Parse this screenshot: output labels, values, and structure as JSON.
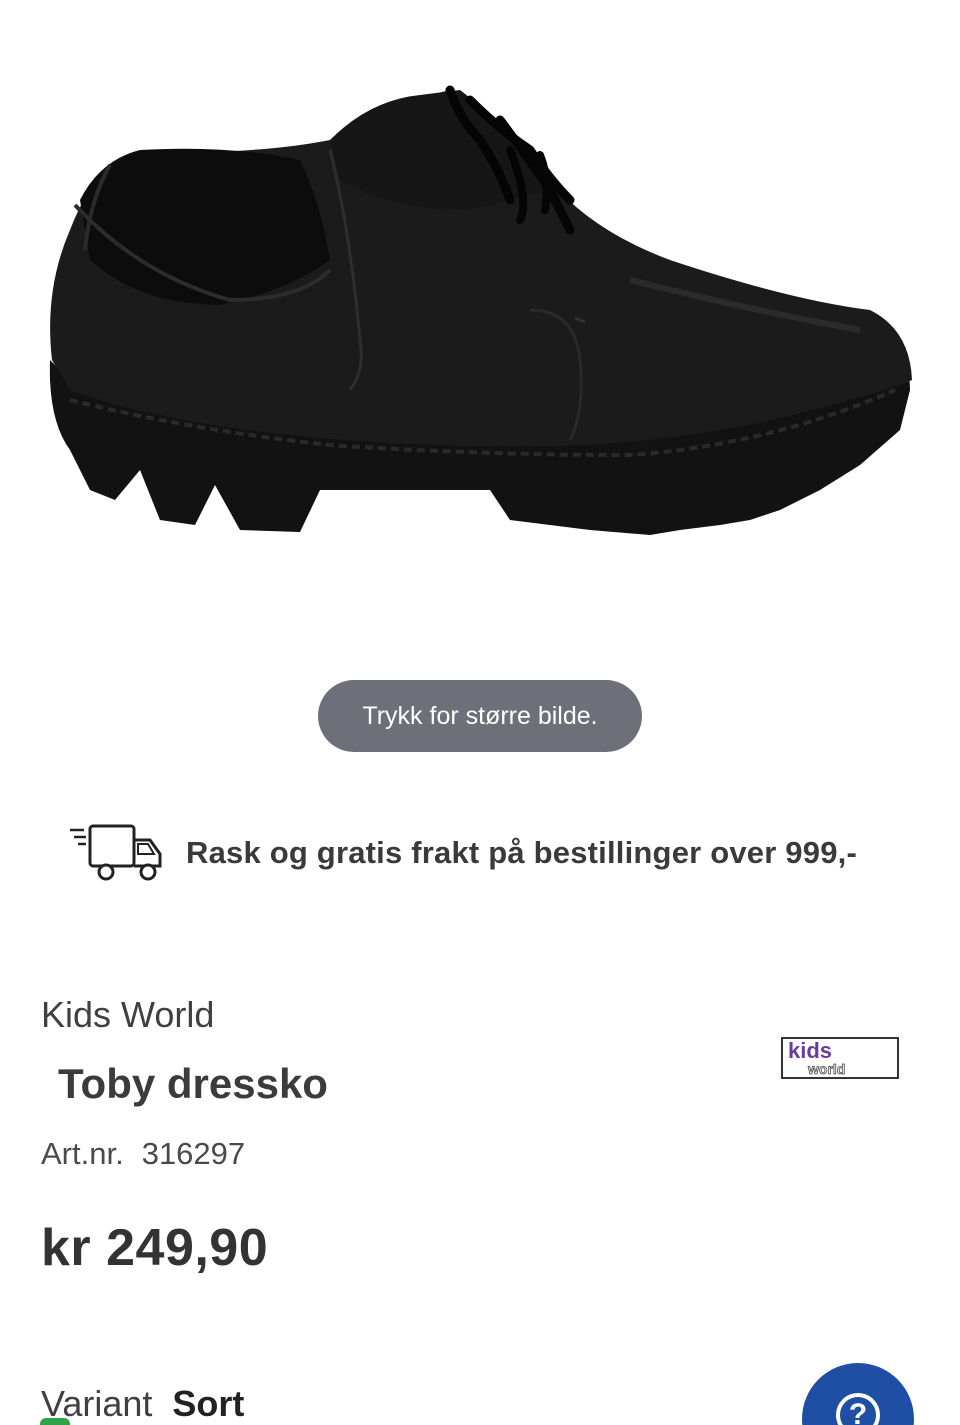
{
  "product": {
    "image_alt": "Toby dressko",
    "zoom_hint": "Trykk for større bilde.",
    "brand": "Kids World",
    "title": "Toby dressko",
    "artnr_label": "Art.nr.",
    "artnr_value": "316297",
    "price": "kr 249,90",
    "variant_label": "Variant",
    "variant_value": "Sort"
  },
  "shipping": {
    "text": "Rask og gratis frakt på bestillinger over 999,-",
    "icon": "delivery-truck-icon"
  },
  "brand_logo": {
    "text_top": "kids",
    "text_bottom": "world"
  },
  "help": {
    "icon": "help-icon",
    "glyph": "?"
  },
  "colors": {
    "zoom_hint_bg": "#6e7079",
    "help_button_bg": "#1f4fa5",
    "text": "#333333"
  }
}
